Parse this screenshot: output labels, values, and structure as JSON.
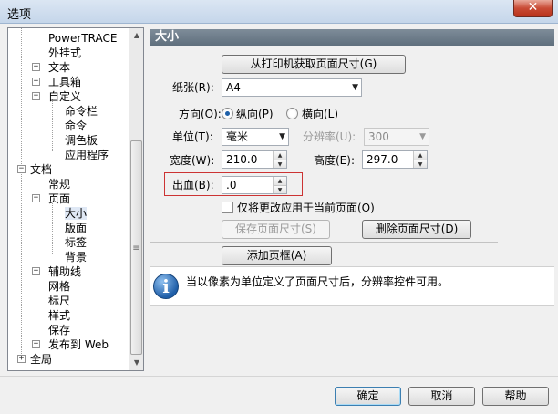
{
  "window": {
    "title": "选项",
    "close_glyph": "✕"
  },
  "tree": {
    "items": [
      {
        "label": "PowerTRACE",
        "level": 2
      },
      {
        "label": "外挂式",
        "level": 2
      },
      {
        "label": "文本",
        "level": 2,
        "expander": "+"
      },
      {
        "label": "工具箱",
        "level": 2,
        "expander": "+"
      },
      {
        "label": "自定义",
        "level": 2,
        "expander": "−"
      },
      {
        "label": "命令栏",
        "level": 3
      },
      {
        "label": "命令",
        "level": 3
      },
      {
        "label": "调色板",
        "level": 3
      },
      {
        "label": "应用程序",
        "level": 3
      },
      {
        "label": "文档",
        "level": 1,
        "expander": "−"
      },
      {
        "label": "常规",
        "level": 2
      },
      {
        "label": "页面",
        "level": 2,
        "expander": "−"
      },
      {
        "label": "大小",
        "level": 3,
        "selected": true
      },
      {
        "label": "版面",
        "level": 3
      },
      {
        "label": "标签",
        "level": 3
      },
      {
        "label": "背景",
        "level": 3
      },
      {
        "label": "辅助线",
        "level": 2,
        "expander": "+"
      },
      {
        "label": "网格",
        "level": 2
      },
      {
        "label": "标尺",
        "level": 2
      },
      {
        "label": "样式",
        "level": 2
      },
      {
        "label": "保存",
        "level": 2
      },
      {
        "label": "发布到 Web",
        "level": 2,
        "expander": "+"
      },
      {
        "label": "全局",
        "level": 1,
        "expander": "+"
      }
    ],
    "scroll_up_glyph": "▲",
    "scroll_down_glyph": "▼",
    "thumb_grip": "≡"
  },
  "panel": {
    "header": "大小",
    "get_from_printer_button": "从打印机获取页面尺寸(G)",
    "paper_label": "纸张(R):",
    "paper_value": "A4",
    "orientation_label": "方向(O):",
    "portrait_label": "纵向(P)",
    "landscape_label": "横向(L)",
    "orientation_selected": "portrait",
    "unit_label": "单位(T):",
    "unit_value": "毫米",
    "resolution_label": "分辨率(U):",
    "resolution_value": "300",
    "width_label": "宽度(W):",
    "width_value": "210.0",
    "height_label": "高度(E):",
    "height_value": "297.0",
    "bleed_label": "出血(B):",
    "bleed_value": ".0",
    "apply_current_only_label": "仅将更改应用于当前页面(O)",
    "apply_current_only_checked": false,
    "save_size_button": "保存页面尺寸(S)",
    "delete_size_button": "删除页面尺寸(D)",
    "add_frame_button": "添加页框(A)",
    "info_icon_glyph": "i",
    "info_text": "当以像素为单位定义了页面尺寸后，分辨率控件可用。",
    "dropdown_glyph": "▼",
    "spin_up_glyph": "▲",
    "spin_down_glyph": "▼"
  },
  "footer": {
    "ok": "确定",
    "cancel": "取消",
    "help": "帮助"
  },
  "colors": {
    "header_bg": "#6b7a88",
    "highlight_border": "#cc3333",
    "info_icon": "#1f5ea8",
    "close_button": "#c94b35"
  }
}
